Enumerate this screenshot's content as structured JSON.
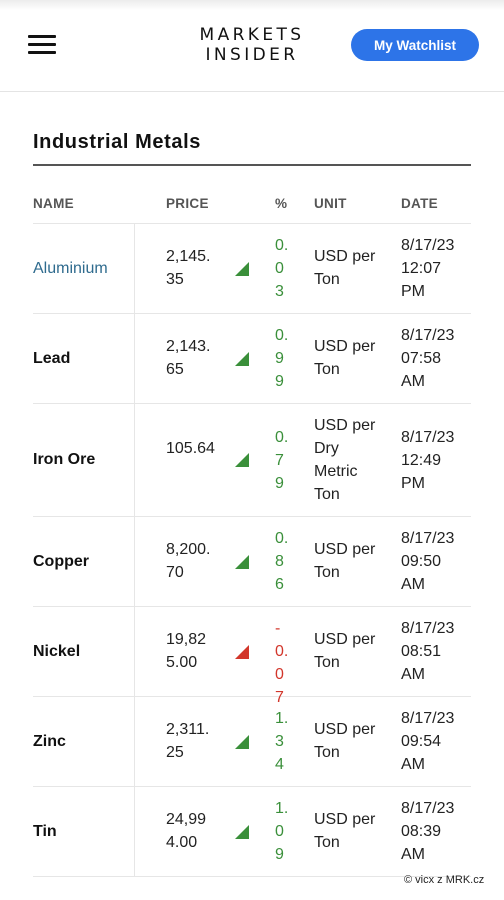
{
  "header": {
    "logo_line1": "MARKETS",
    "logo_line2": "INSIDER",
    "watchlist_label": "My Watchlist"
  },
  "section_title": "Industrial Metals",
  "columns": {
    "name": "NAME",
    "price": "PRICE",
    "pct": "%",
    "unit": "UNIT",
    "date": "DATE"
  },
  "rows": [
    {
      "name": "Aluminium",
      "price": "2,145.35",
      "pct": "0.03",
      "unit": "USD per Ton",
      "date_line1": "8/17/23",
      "date_line2": "12:07",
      "date_line3": "PM",
      "direction": "up"
    },
    {
      "name": "Lead",
      "price": "2,143.65",
      "pct": "0.99",
      "unit": "USD per Ton",
      "date_line1": "8/17/23",
      "date_line2": "07:58",
      "date_line3": "AM",
      "direction": "up"
    },
    {
      "name": "Iron Ore",
      "price": "105.64",
      "pct": "0.79",
      "unit": "USD per Dry Metric Ton",
      "date_line1": "8/17/23",
      "date_line2": "12:49",
      "date_line3": "PM",
      "direction": "up"
    },
    {
      "name": "Copper",
      "price": "8,200.70",
      "pct": "0.86",
      "unit": "USD per Ton",
      "date_line1": "8/17/23",
      "date_line2": "09:50",
      "date_line3": "AM",
      "direction": "up"
    },
    {
      "name": "Nickel",
      "price": "19,825.00",
      "pct": "-0.07",
      "unit": "USD per Ton",
      "date_line1": "8/17/23",
      "date_line2": "08:51",
      "date_line3": "AM",
      "direction": "down"
    },
    {
      "name": "Zinc",
      "price": "2,311.25",
      "pct": "1.34",
      "unit": "USD per Ton",
      "date_line1": "8/17/23",
      "date_line2": "09:54",
      "date_line3": "AM",
      "direction": "up"
    },
    {
      "name": "Tin",
      "price": "24,994.00",
      "pct": "1.09",
      "unit": "USD per Ton",
      "date_line1": "8/17/23",
      "date_line2": "08:39",
      "date_line3": "AM",
      "direction": "up"
    }
  ],
  "colors": {
    "up": "#3a8f3a",
    "down": "#d2362b",
    "accent": "#2d74e8",
    "link": "#2f6b8e"
  },
  "credit": "© vicx z MRK.cz"
}
